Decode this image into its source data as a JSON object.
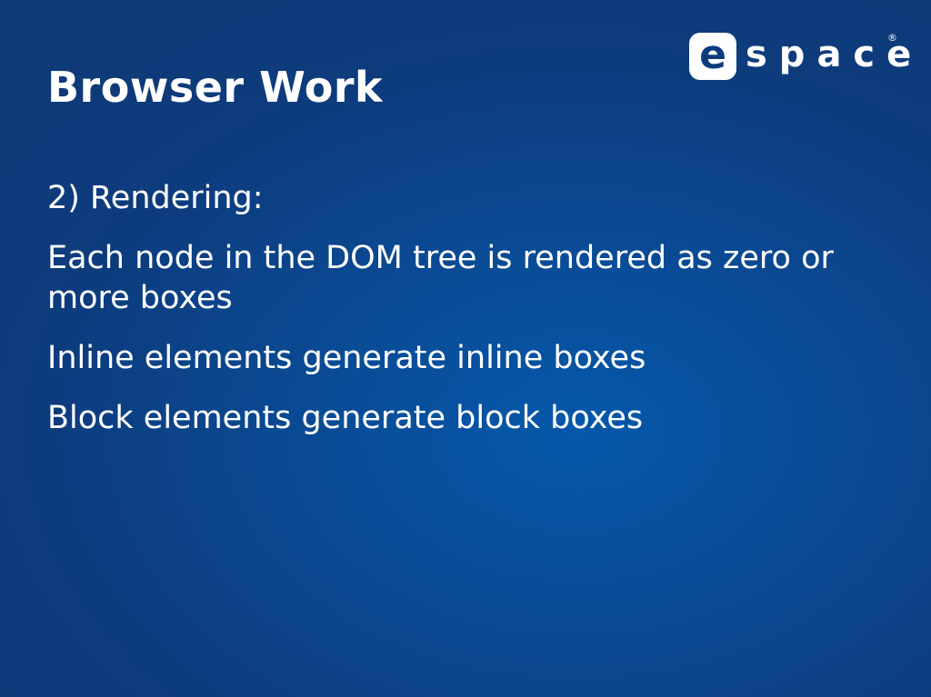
{
  "slide": {
    "title": "Browser Work",
    "logo": {
      "letter": "e",
      "text": "space",
      "registered": "®"
    },
    "paragraphs": [
      "2) Rendering:",
      "Each node in the DOM tree is rendered as zero or more boxes",
      "Inline elements generate inline boxes",
      "Block elements generate block boxes"
    ]
  }
}
